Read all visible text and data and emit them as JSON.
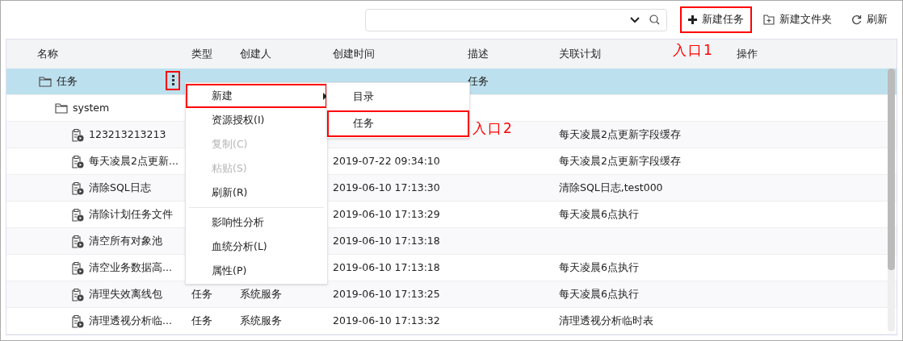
{
  "toolbar": {
    "buttons": [
      {
        "kind": "plus",
        "label": "新建任务",
        "annotated": true
      },
      {
        "kind": "folder-plus",
        "label": "新建文件夹",
        "annotated": false
      },
      {
        "kind": "refresh",
        "label": "刷新",
        "annotated": false
      }
    ]
  },
  "table": {
    "columns": [
      "名称",
      "类型",
      "创建人",
      "创建时间",
      "描述",
      "关联计划",
      "操作"
    ],
    "rows": [
      {
        "kind": "folder",
        "name": "任务",
        "description": "任务",
        "selected": true,
        "more_button_annotated": true,
        "children": [
          {
            "kind": "folder",
            "name": "system",
            "selected": false,
            "children": [
              {
                "kind": "task",
                "name": "123213213213",
                "plan": "每天凌晨2点更新字段缓存",
                "selected": false
              },
              {
                "kind": "task",
                "name": "每天凌晨2点更新...",
                "created": "2019-07-22 09:34:10",
                "plan": "每天凌晨2点更新字段缓存",
                "selected": false
              },
              {
                "kind": "task",
                "name": "清除SQL日志",
                "created": "2019-06-10 17:13:30",
                "plan": "清除SQL日志,test000",
                "selected": false
              },
              {
                "kind": "task",
                "name": "清除计划任务文件",
                "created": "2019-06-10 17:13:29",
                "plan": "每天凌晨6点执行",
                "selected": false
              },
              {
                "kind": "task",
                "name": "清空所有对象池",
                "created": "2019-06-10 17:13:18",
                "selected": false
              },
              {
                "kind": "task",
                "name": "清空业务数据高...",
                "created": "2019-06-10 17:13:18",
                "plan": "每天凌晨6点执行",
                "selected": false
              },
              {
                "kind": "task",
                "name": "清理失效离线包",
                "type": "任务",
                "creator": "系统服务",
                "created": "2019-06-10 17:13:25",
                "plan": "每天凌晨6点执行",
                "selected": false
              },
              {
                "kind": "task",
                "name": "清理透视分析临...",
                "type": "任务",
                "creator": "系统服务",
                "created": "2019-06-10 17:13:32",
                "plan": "清理透视分析临时表",
                "selected": false
              }
            ]
          }
        ]
      }
    ]
  },
  "context_menu": {
    "items": [
      {
        "kind": "item",
        "label": "新建",
        "disabled": false,
        "has_submenu": true,
        "annotated": true
      },
      {
        "kind": "item",
        "label": "资源授权(I)",
        "disabled": false,
        "has_submenu": false,
        "annotated": false
      },
      {
        "kind": "item",
        "label": "复制(C)",
        "disabled": true,
        "has_submenu": false,
        "annotated": false
      },
      {
        "kind": "item",
        "label": "粘贴(S)",
        "disabled": true,
        "has_submenu": false,
        "annotated": false
      },
      {
        "kind": "item",
        "label": "刷新(R)",
        "disabled": false,
        "has_submenu": false,
        "annotated": false
      },
      {
        "kind": "separator"
      },
      {
        "kind": "item",
        "label": "影响性分析",
        "disabled": false,
        "has_submenu": false,
        "annotated": false
      },
      {
        "kind": "item",
        "label": "血统分析(L)",
        "disabled": false,
        "has_submenu": false,
        "annotated": false
      },
      {
        "kind": "item",
        "label": "属性(P)",
        "disabled": false,
        "has_submenu": false,
        "annotated": false
      }
    ],
    "submenu": [
      {
        "label": "目录",
        "annotated": false
      },
      {
        "label": "任务",
        "annotated": true
      }
    ]
  },
  "annotations": [
    "入口1",
    "入口2"
  ]
}
